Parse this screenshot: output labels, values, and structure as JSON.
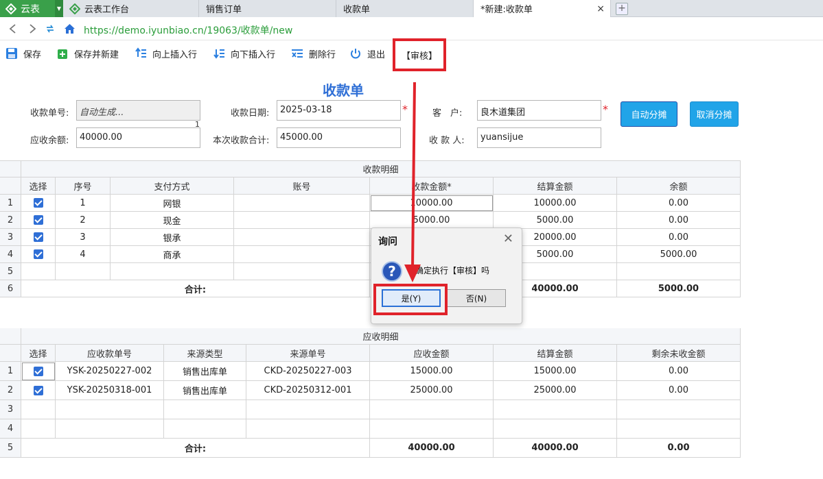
{
  "tabs": {
    "app_name": "云表",
    "items": [
      "云表工作台",
      "销售订单",
      "收款单",
      "*新建:收款单"
    ],
    "close_glyph": "×",
    "new_tab_glyph": "+"
  },
  "address": {
    "url": "https://demo.iyunbiao.cn/19063/收款单/new"
  },
  "toolbar": {
    "save": "保存",
    "save_new": "保存并新建",
    "insert_up": "向上插入行",
    "insert_down": "向下插入行",
    "delete_row": "删除行",
    "exit": "退出",
    "audit": "【审核】"
  },
  "form": {
    "title": "收款单",
    "receipt_no_label": "收款单号:",
    "receipt_no_value": "自动生成...",
    "receipt_no_marker": "1",
    "date_label": "收款日期:",
    "date_value": "2025-03-18",
    "customer_label": "客　户:",
    "customer_value": "良木道集团",
    "balance_label": "应收余额:",
    "balance_value": "40000.00",
    "total_label": "本次收款合计:",
    "total_value": "45000.00",
    "payee_label": "收 款 人:",
    "payee_value": "yuansijue",
    "required_mark": "*",
    "auto_alloc": "自动分摊",
    "cancel_alloc": "取消分摊"
  },
  "detail": {
    "caption": "收款明细",
    "headers": [
      "选择",
      "序号",
      "支付方式",
      "账号",
      "收款金额*",
      "结算金额",
      "余额"
    ],
    "rows": [
      {
        "rn": "1",
        "seq": "1",
        "method": "网银",
        "account": "",
        "amount": "10000.00",
        "settle": "10000.00",
        "balance": "0.00",
        "checked": true
      },
      {
        "rn": "2",
        "seq": "2",
        "method": "现金",
        "account": "",
        "amount": "5000.00",
        "settle": "5000.00",
        "balance": "0.00",
        "checked": true
      },
      {
        "rn": "3",
        "seq": "3",
        "method": "银承",
        "account": "",
        "amount": "",
        "settle": "20000.00",
        "balance": "0.00",
        "checked": true
      },
      {
        "rn": "4",
        "seq": "4",
        "method": "商承",
        "account": "",
        "amount": "",
        "settle": "5000.00",
        "balance": "5000.00",
        "checked": true
      },
      {
        "rn": "5",
        "seq": "",
        "method": "",
        "account": "",
        "amount": "",
        "settle": "",
        "balance": "",
        "checked": false
      }
    ],
    "total_rn": "6",
    "total_label": "合计:",
    "total_settle": "40000.00",
    "total_balance": "5000.00"
  },
  "receivable": {
    "caption": "应收明细",
    "headers": [
      "选择",
      "应收款单号",
      "来源类型",
      "来源单号",
      "应收金额",
      "结算金额",
      "剩余未收金额"
    ],
    "rows": [
      {
        "rn": "1",
        "no": "YSK-20250227-002",
        "type": "销售出库单",
        "src": "CKD-20250227-003",
        "due": "15000.00",
        "settle": "15000.00",
        "remain": "0.00",
        "checked": true
      },
      {
        "rn": "2",
        "no": "YSK-20250318-001",
        "type": "销售出库单",
        "src": "CKD-20250312-001",
        "due": "25000.00",
        "settle": "25000.00",
        "remain": "0.00",
        "checked": true
      },
      {
        "rn": "3",
        "no": "",
        "type": "",
        "src": "",
        "due": "",
        "settle": "",
        "remain": "",
        "checked": false
      },
      {
        "rn": "4",
        "no": "",
        "type": "",
        "src": "",
        "due": "",
        "settle": "",
        "remain": "",
        "checked": false
      }
    ],
    "total_rn": "5",
    "total_label": "合计:",
    "total_due": "40000.00",
    "total_settle": "40000.00",
    "total_remain": "0.00"
  },
  "dialog": {
    "title": "询问",
    "close": "✕",
    "icon_glyph": "?",
    "message": "确定执行【审核】吗",
    "yes": "是(Y)",
    "no": "否(N)"
  },
  "colors": {
    "accent": "#2f6fd6",
    "highlight": "#e0222a",
    "app_green": "#3aa04a",
    "url_green": "#2a9d3a",
    "button_blue": "#21a4e8"
  }
}
